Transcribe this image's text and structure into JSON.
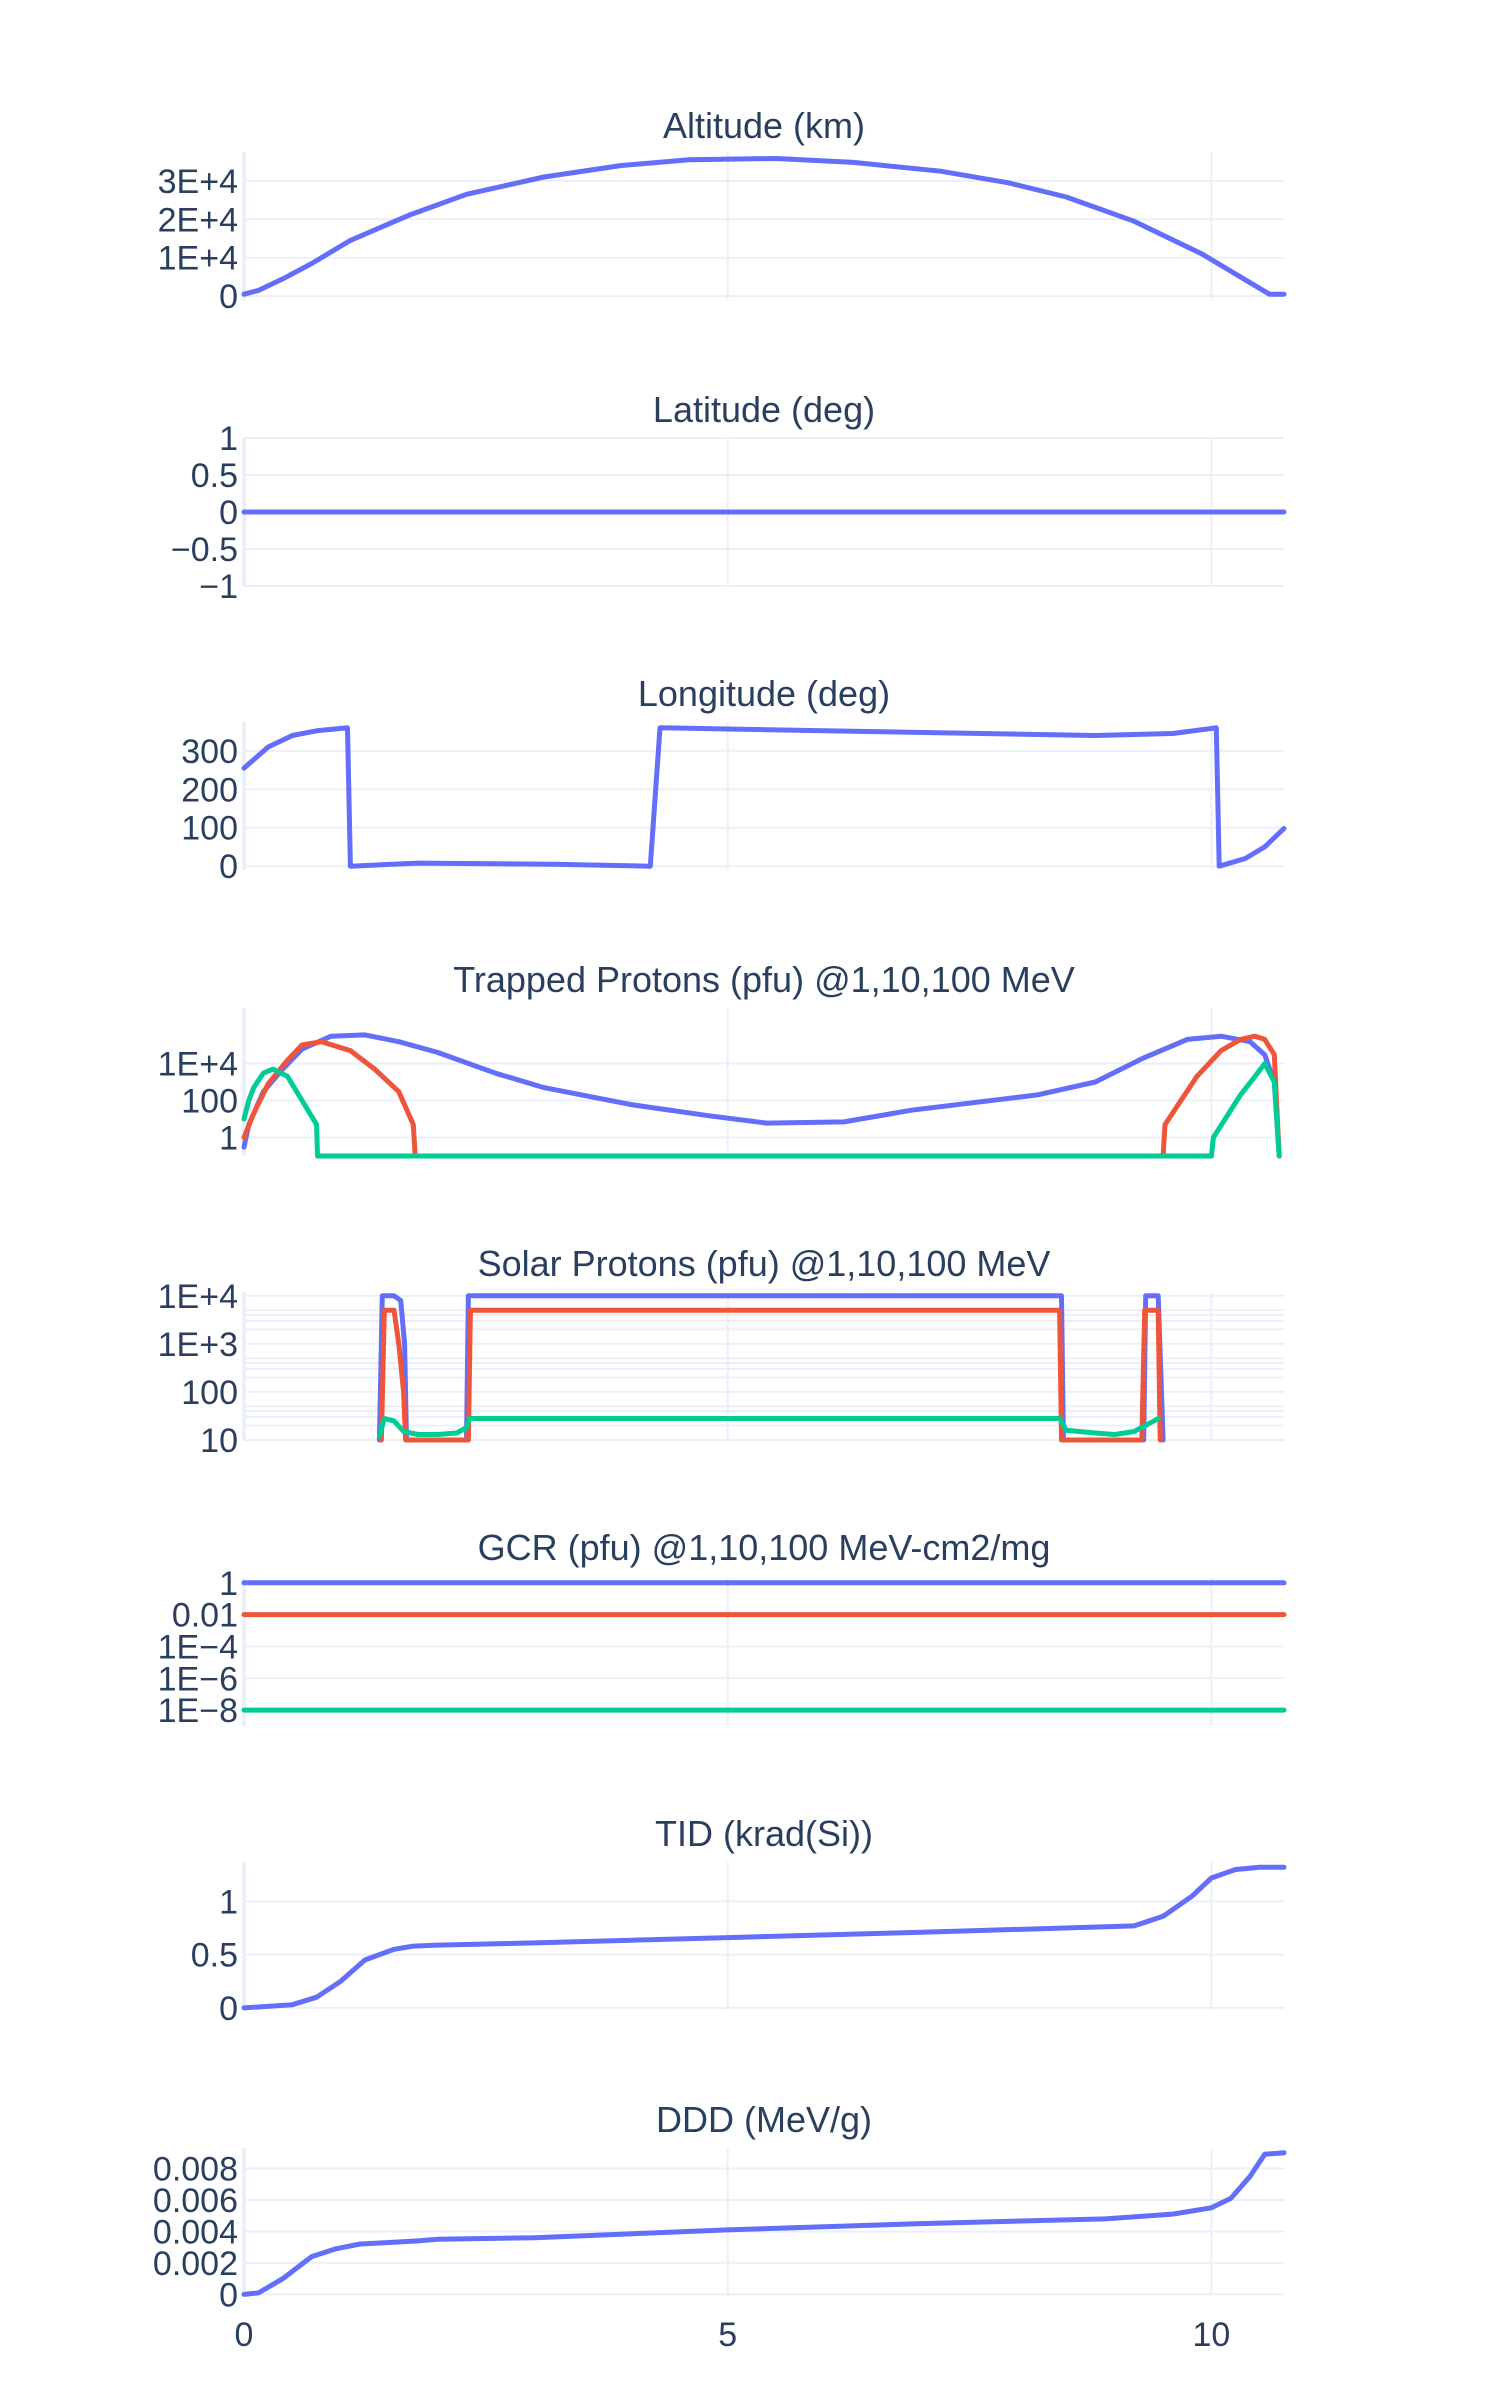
{
  "figure": {
    "background": "#ffffff",
    "text_color": "#2a3f5f",
    "grid_color": "#ebf0f8"
  },
  "colors": {
    "series1": "#636efa",
    "series2": "#ef553b",
    "series3": "#00cc96"
  },
  "x_axis": {
    "range": [
      0,
      10.75
    ],
    "ticks": [
      0,
      5,
      10
    ],
    "tick_labels": [
      "0",
      "5",
      "10"
    ]
  },
  "chart_data": [
    {
      "type": "line",
      "title": "Altitude (km)",
      "yscale": "linear",
      "ylim": [
        -1000,
        37500
      ],
      "ytick_values": [
        0,
        10000,
        20000,
        30000
      ],
      "ytick_labels": [
        "0",
        "1E+4",
        "2E+4",
        "3E+4"
      ],
      "series": [
        {
          "color": "#636efa",
          "x": [
            0,
            0.15,
            0.4,
            0.7,
            1.1,
            1.7,
            2.3,
            3.1,
            3.9,
            4.6,
            5.5,
            6.3,
            7.2,
            7.9,
            8.5,
            9.2,
            9.9,
            10.4,
            10.6,
            10.75
          ],
          "y": [
            500,
            1500,
            4500,
            8500,
            14500,
            21000,
            26500,
            31000,
            34000,
            35500,
            35800,
            34800,
            32500,
            29500,
            25800,
            19500,
            11000,
            3500,
            500,
            500
          ]
        }
      ]
    },
    {
      "type": "line",
      "title": "Latitude (deg)",
      "yscale": "linear",
      "ylim": [
        -1,
        1
      ],
      "ytick_values": [
        -1,
        -0.5,
        0,
        0.5,
        1
      ],
      "ytick_labels": [
        "−1",
        "−0.5",
        "0",
        "0.5",
        "1"
      ],
      "series": [
        {
          "color": "#636efa",
          "x": [
            0,
            10.75
          ],
          "y": [
            0,
            0
          ]
        }
      ]
    },
    {
      "type": "line",
      "title": "Longitude (deg)",
      "yscale": "linear",
      "ylim": [
        -10,
        375
      ],
      "ytick_values": [
        0,
        100,
        200,
        300
      ],
      "ytick_labels": [
        "0",
        "100",
        "200",
        "300"
      ],
      "series": [
        {
          "color": "#636efa",
          "x": [
            0,
            0.25,
            0.5,
            0.75,
            1.07,
            1.1,
            1.8,
            3.2,
            4.2,
            4.3,
            6.0,
            8.8,
            9.6,
            10.05,
            10.08,
            10.35,
            10.55,
            10.75
          ],
          "y": [
            255,
            310,
            340,
            352,
            360,
            0,
            8,
            5,
            0,
            360,
            352,
            340,
            345,
            360,
            0,
            20,
            50,
            98
          ]
        }
      ]
    },
    {
      "type": "line",
      "title": "Trapped Protons (pfu) @1,10,100 MeV",
      "yscale": "log",
      "ylim": [
        0.1,
        10000000
      ],
      "ytick_values": [
        1,
        100,
        10000
      ],
      "ytick_labels": [
        "1",
        "100",
        "1E+4"
      ],
      "series": [
        {
          "color": "#636efa",
          "x": [
            0,
            0.05,
            0.2,
            0.4,
            0.6,
            0.9,
            1.25,
            1.6,
            2.0,
            2.6,
            3.1,
            4.0,
            4.8,
            5.4,
            6.2,
            6.9,
            8.2,
            8.8,
            9.3,
            9.75,
            10.1,
            10.4,
            10.55,
            10.65,
            10.7
          ],
          "y": [
            0.3,
            5,
            300,
            5000,
            60000,
            300000,
            350000,
            150000,
            40000,
            3000,
            500,
            60,
            15,
            6,
            7,
            30,
            200,
            1000,
            20000,
            200000,
            300000,
            150000,
            30000,
            1000,
            0.1
          ]
        },
        {
          "color": "#ef553b",
          "x": [
            0,
            0.1,
            0.25,
            0.45,
            0.6,
            0.8,
            1.1,
            1.35,
            1.6,
            1.75,
            1.77,
            9.5,
            9.52,
            9.85,
            10.1,
            10.3,
            10.45,
            10.55,
            10.65,
            10.7
          ],
          "y": [
            1,
            20,
            800,
            15000,
            100000,
            150000,
            50000,
            5000,
            300,
            5,
            0.1,
            0.1,
            5,
            2000,
            50000,
            200000,
            300000,
            200000,
            30000,
            0.1
          ]
        },
        {
          "color": "#00cc96",
          "x": [
            0,
            0.05,
            0.1,
            0.2,
            0.3,
            0.45,
            0.6,
            0.75,
            0.76,
            10.0,
            10.02,
            10.3,
            10.45,
            10.55,
            10.65,
            10.7
          ],
          "y": [
            10,
            100,
            500,
            3000,
            5000,
            2000,
            100,
            5,
            0.1,
            0.1,
            1,
            200,
            2000,
            10000,
            1000,
            0.1
          ]
        }
      ]
    },
    {
      "type": "line",
      "title": "Solar Protons (pfu) @1,10,100 MeV",
      "yscale": "log",
      "ylim": [
        10,
        12000
      ],
      "ytick_values": [
        10,
        100,
        1000,
        10000
      ],
      "ytick_labels": [
        "10",
        "100",
        "1E+3",
        "1E+4"
      ],
      "minor_ticks": [
        20,
        30,
        40,
        50,
        200,
        300,
        400,
        500,
        2000,
        3000,
        4000,
        5000
      ],
      "series": [
        {
          "color": "#636efa",
          "x": [
            1.4,
            1.43,
            1.55,
            1.62,
            1.66,
            1.68,
            2.3,
            2.32,
            8.45,
            8.47,
            9.3,
            9.32,
            9.4,
            9.45,
            9.5
          ],
          "y": [
            10,
            10000,
            10000,
            8000,
            1000,
            10,
            10,
            10000,
            10000,
            10,
            10,
            10000,
            10000,
            10000,
            10
          ]
        },
        {
          "color": "#ef553b",
          "x": [
            1.42,
            1.45,
            1.55,
            1.6,
            1.65,
            1.67,
            2.32,
            2.34,
            8.43,
            8.45,
            9.28,
            9.31,
            9.38,
            9.45,
            9.47
          ],
          "y": [
            10,
            5000,
            5000,
            1000,
            100,
            10,
            10,
            5000,
            5000,
            10,
            10,
            5000,
            5000,
            5000,
            10
          ]
        },
        {
          "color": "#00cc96",
          "x": [
            1.4,
            1.45,
            1.55,
            1.65,
            1.8,
            2.0,
            2.2,
            2.3,
            2.33,
            8.43,
            8.5,
            8.8,
            9.0,
            9.2,
            9.32,
            9.45
          ],
          "y": [
            12,
            28,
            25,
            15,
            13,
            13,
            14,
            18,
            28,
            28,
            16,
            14,
            13,
            15,
            20,
            28
          ]
        }
      ]
    },
    {
      "type": "line",
      "title": "GCR (pfu) @1,10,100 MeV-cm2/mg",
      "yscale": "log",
      "ylim": [
        1e-09,
        2
      ],
      "ytick_values": [
        1e-08,
        1e-06,
        0.0001,
        0.01,
        1
      ],
      "ytick_labels": [
        "1E−8",
        "1E−6",
        "1E−4",
        "0.01",
        "1"
      ],
      "series": [
        {
          "color": "#636efa",
          "x": [
            0,
            10.75
          ],
          "y": [
            1,
            1
          ]
        },
        {
          "color": "#ef553b",
          "x": [
            0,
            10.75
          ],
          "y": [
            0.01,
            0.01
          ]
        },
        {
          "color": "#00cc96",
          "x": [
            0,
            10.75
          ],
          "y": [
            1e-08,
            1e-08
          ]
        }
      ]
    },
    {
      "type": "line",
      "title": "TID (krad(Si))",
      "yscale": "linear",
      "ylim": [
        -0.02,
        1.37
      ],
      "ytick_values": [
        0,
        0.5,
        1
      ],
      "ytick_labels": [
        "0",
        "0.5",
        "1"
      ],
      "series": [
        {
          "color": "#636efa",
          "x": [
            0,
            0.5,
            0.75,
            1.0,
            1.25,
            1.55,
            1.75,
            2.0,
            3.0,
            5.0,
            7.0,
            9.2,
            9.5,
            9.8,
            10.0,
            10.25,
            10.5,
            10.75
          ],
          "y": [
            0,
            0.03,
            0.1,
            0.25,
            0.45,
            0.55,
            0.58,
            0.59,
            0.61,
            0.66,
            0.71,
            0.77,
            0.86,
            1.05,
            1.22,
            1.3,
            1.32,
            1.32
          ]
        }
      ]
    },
    {
      "type": "line",
      "title": "DDD (MeV/g)",
      "yscale": "linear",
      "ylim": [
        -0.0001,
        0.0093
      ],
      "ytick_values": [
        0,
        0.002,
        0.004,
        0.006,
        0.008
      ],
      "ytick_labels": [
        "0",
        "0.002",
        "0.004",
        "0.006",
        "0.008"
      ],
      "series": [
        {
          "color": "#636efa",
          "x": [
            0,
            0.15,
            0.4,
            0.7,
            0.95,
            1.2,
            1.5,
            1.8,
            2.0,
            3.0,
            5.0,
            7.0,
            8.9,
            9.6,
            10.0,
            10.2,
            10.4,
            10.55,
            10.75
          ],
          "y": [
            0,
            0.0001,
            0.001,
            0.0024,
            0.0029,
            0.0032,
            0.0033,
            0.0034,
            0.0035,
            0.0036,
            0.0041,
            0.0045,
            0.0048,
            0.0051,
            0.0055,
            0.0061,
            0.0075,
            0.0089,
            0.009
          ]
        }
      ]
    }
  ]
}
